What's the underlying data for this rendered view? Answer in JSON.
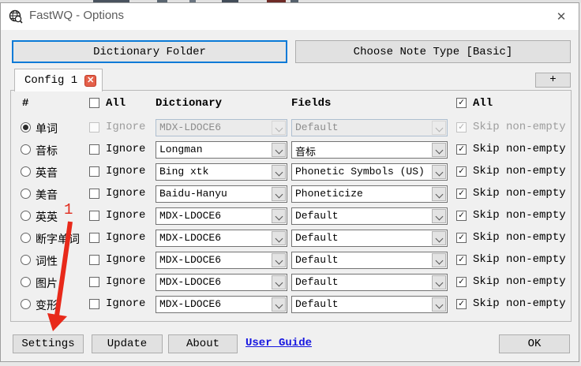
{
  "window": {
    "title": "FastWQ - Options",
    "close_glyph": "✕"
  },
  "top_buttons": {
    "dictionary_folder": "Dictionary Folder",
    "choose_note_type": "Choose Note Type [Basic]"
  },
  "tabs": {
    "config_tab": "Config 1",
    "tab_close_glyph": "✕",
    "add_tab": "+"
  },
  "table": {
    "headers": {
      "index": "#",
      "all_left": "All",
      "dictionary": "Dictionary",
      "fields": "Fields",
      "all_right": "All"
    },
    "ignore_label": "Ignore",
    "skip_label": "Skip non-empty",
    "rows": [
      {
        "label": "单词",
        "selected": true,
        "disabled": true,
        "ignore_checked": false,
        "dictionary": "MDX-LDOCE6",
        "field": "Default",
        "skip_checked": true
      },
      {
        "label": "音标",
        "selected": false,
        "disabled": false,
        "ignore_checked": false,
        "dictionary": "Longman",
        "field": "音标",
        "skip_checked": true
      },
      {
        "label": "英音",
        "selected": false,
        "disabled": false,
        "ignore_checked": false,
        "dictionary": "Bing xtk",
        "field": "Phonetic Symbols (US)",
        "skip_checked": true
      },
      {
        "label": "美音",
        "selected": false,
        "disabled": false,
        "ignore_checked": false,
        "dictionary": "Baidu-Hanyu",
        "field": "Phoneticize",
        "skip_checked": true
      },
      {
        "label": "英英",
        "selected": false,
        "disabled": false,
        "ignore_checked": false,
        "dictionary": "MDX-LDOCE6",
        "field": "Default",
        "skip_checked": true
      },
      {
        "label": "断字单词",
        "selected": false,
        "disabled": false,
        "ignore_checked": false,
        "dictionary": "MDX-LDOCE6",
        "field": "Default",
        "skip_checked": true
      },
      {
        "label": "词性",
        "selected": false,
        "disabled": false,
        "ignore_checked": false,
        "dictionary": "MDX-LDOCE6",
        "field": "Default",
        "skip_checked": true
      },
      {
        "label": "图片",
        "selected": false,
        "disabled": false,
        "ignore_checked": false,
        "dictionary": "MDX-LDOCE6",
        "field": "Default",
        "skip_checked": true
      },
      {
        "label": "变形",
        "selected": false,
        "disabled": false,
        "ignore_checked": false,
        "dictionary": "MDX-LDOCE6",
        "field": "Default",
        "skip_checked": true
      }
    ],
    "all_left_checked": false,
    "all_right_checked": true
  },
  "footer": {
    "settings": "Settings",
    "update": "Update",
    "about": "About",
    "user_guide": "User Guide",
    "ok": "OK"
  },
  "annotation": {
    "label": "1",
    "color": "#e02b1d"
  },
  "colors": {
    "focus_border": "#0a7ad7",
    "tab_close_bg": "#e4604a",
    "link": "#1616e0",
    "annotation_red": "#e02b1d",
    "dialog_bg": "#f0f0f0",
    "titlebar_bg": "#ffffff"
  }
}
